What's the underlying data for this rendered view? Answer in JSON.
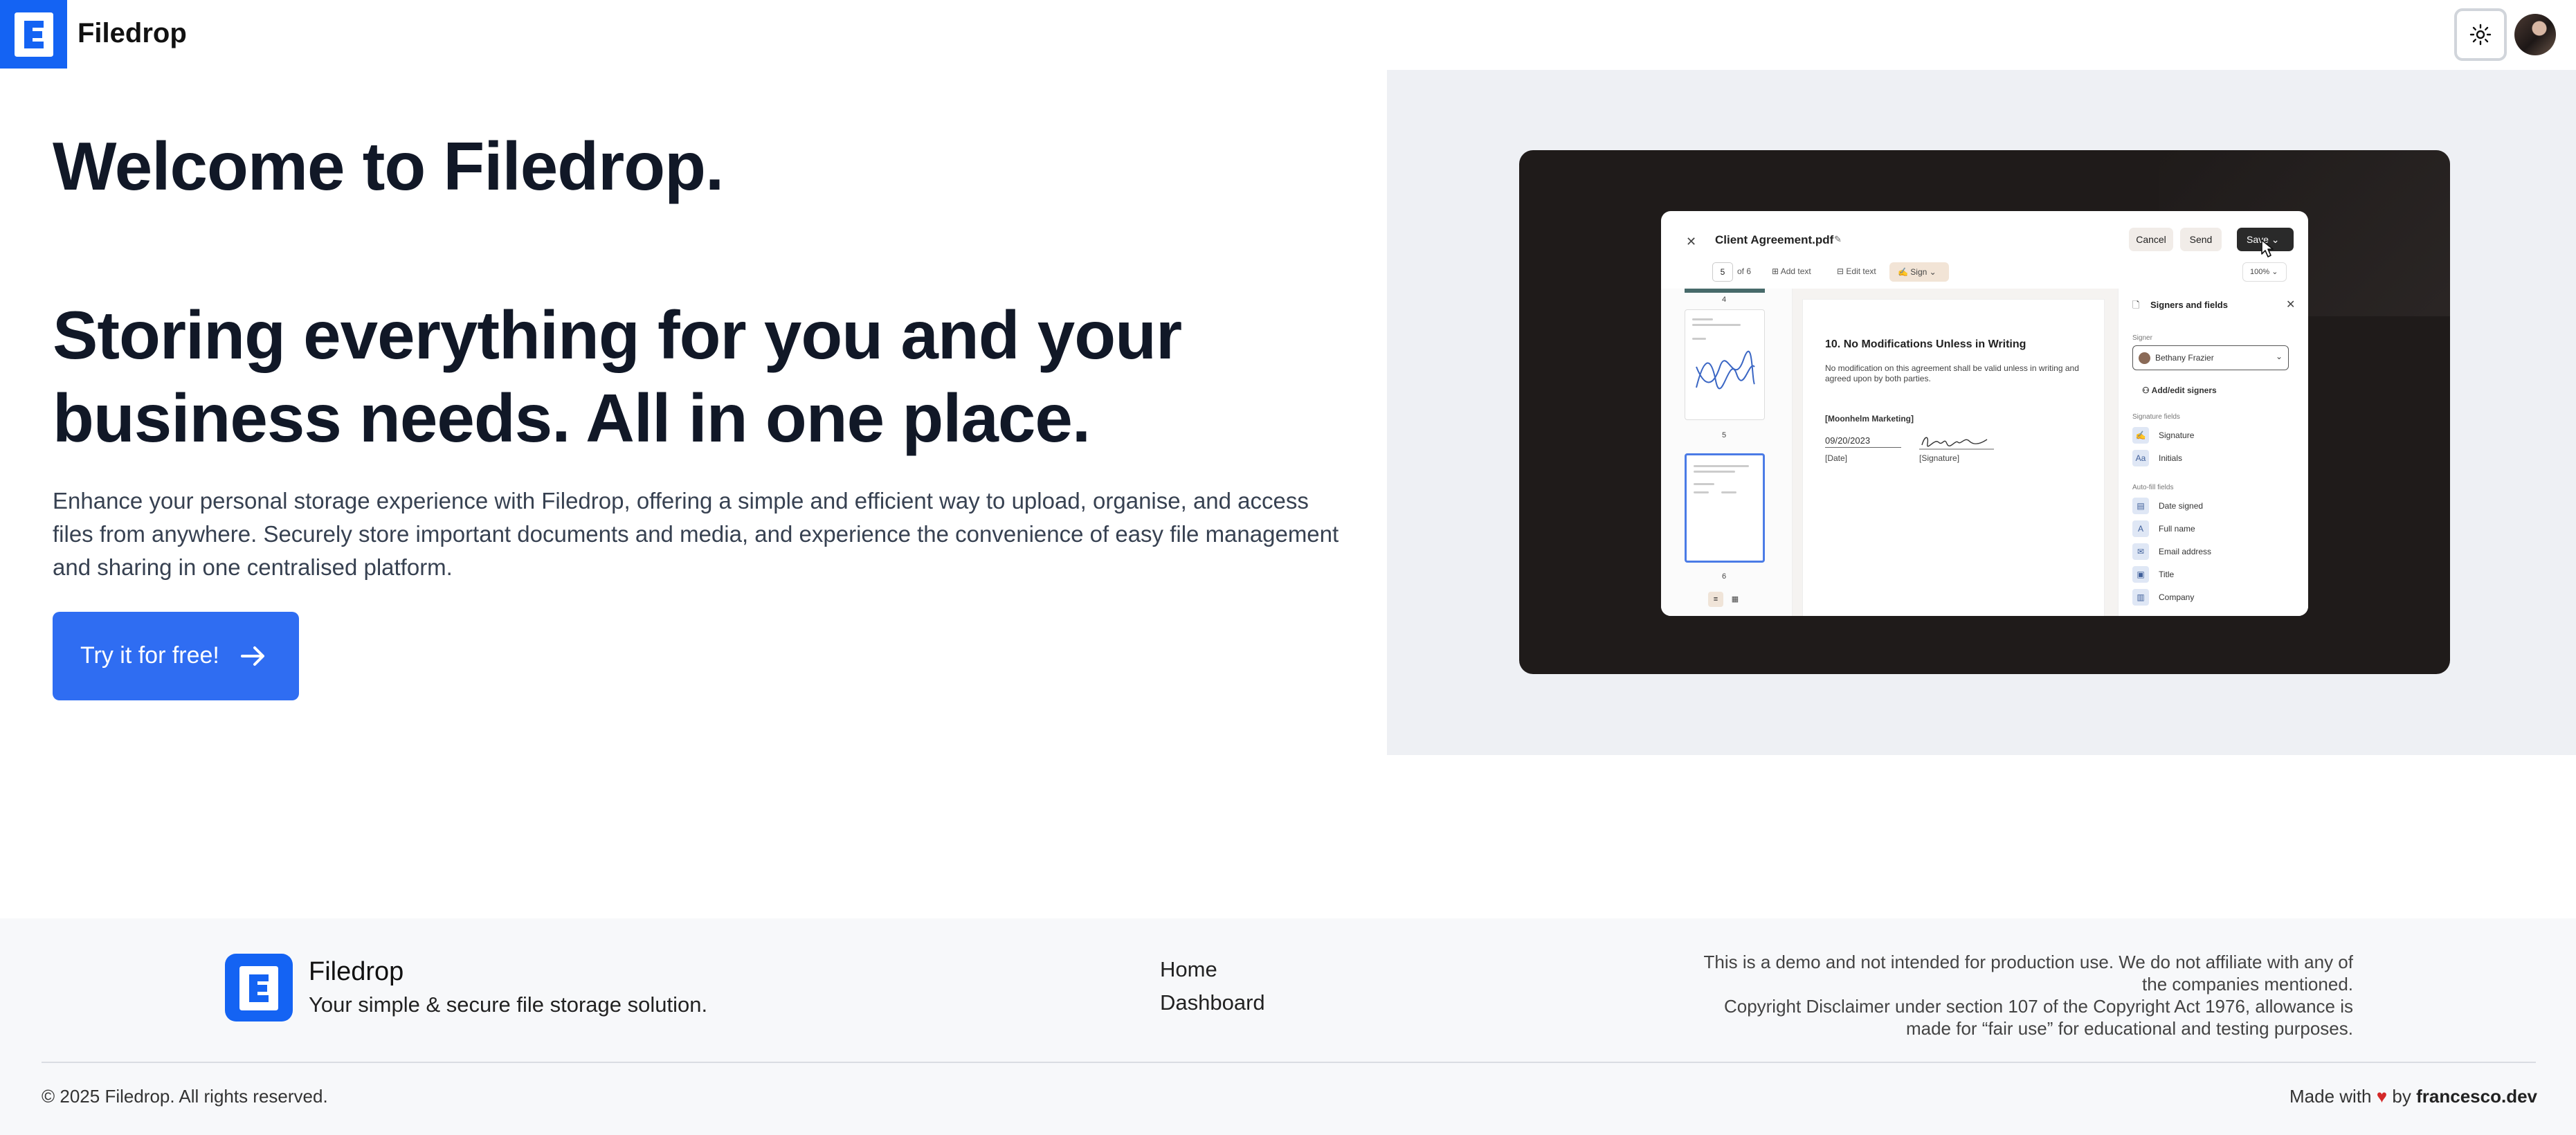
{
  "header": {
    "brand": "Filedrop",
    "theme_toggle": "sun-icon",
    "avatar": "user-avatar"
  },
  "hero": {
    "welcome": "Welcome to Filedrop.",
    "headline": "Storing everything for you and your business needs. All in one place.",
    "description": "Enhance your personal storage experience with Filedrop, offering a simple and efficient way to upload, organise, and access files from anywhere. Securely store important documents and media, and experience the convenience of easy file management and sharing in one centralised platform.",
    "cta_label": "Try it for free!"
  },
  "preview": {
    "doc_title": "Client Agreement.pdf",
    "cancel": "Cancel",
    "send": "Send",
    "save": "Save",
    "page_current": "5",
    "page_total": "of 6",
    "add_text": "Add text",
    "edit_text": "Edit text",
    "sign": "Sign",
    "zoom": "100%",
    "thumb_labels": [
      "4",
      "5",
      "6"
    ],
    "page_heading": "10. No Modifications Unless in Writing",
    "page_text": "No modification on this agreement shall be valid unless in writing and agreed upon by both parties.",
    "company": "[Moonhelm Marketing]",
    "date_value": "09/20/2023",
    "date_label": "[Date]",
    "signature_label": "[Signature]",
    "sidebar_title": "Signers and fields",
    "signer_label": "Signer",
    "signer_name": "Bethany Frazier",
    "add_signers": "Add/edit signers",
    "signature_fields_label": "Signature fields",
    "signature_fields": [
      "Signature",
      "Initials"
    ],
    "autofill_label": "Auto-fill fields",
    "autofill_fields": [
      "Date signed",
      "Full name",
      "Email address",
      "Title",
      "Company"
    ]
  },
  "footer": {
    "brand": "Filedrop",
    "tagline": "Your simple & secure file storage solution.",
    "links": [
      "Home",
      "Dashboard"
    ],
    "disclaimer_1": "This is a demo and not intended for production use. We do not affiliate with any of the companies mentioned.",
    "disclaimer_2": "Copyright Disclaimer under section 107 of the Copyright Act 1976, allowance is made for “fair use” for educational and testing purposes.",
    "copyright": "© 2025 Filedrop. All rights reserved.",
    "made_with": "Made with",
    "made_by": "by",
    "author": "francesco.dev"
  },
  "colors": {
    "brand_blue": "#1463f3",
    "cta_blue": "#2f6df2",
    "panel_bg": "#eef0f4",
    "frame_bg": "#1f1b1a"
  }
}
